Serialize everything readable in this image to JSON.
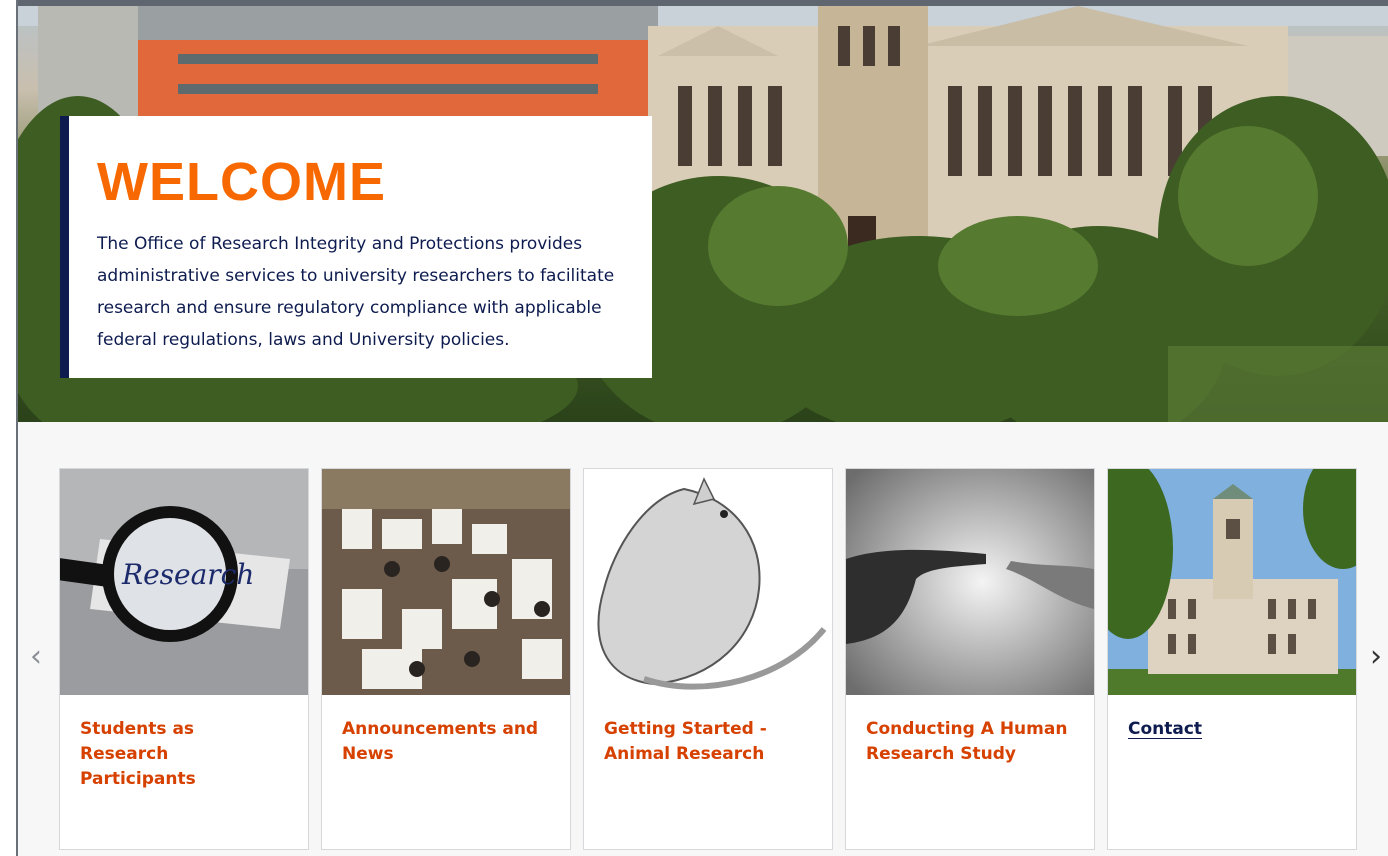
{
  "hero": {
    "title": "WELCOME",
    "description": "The Office of Research Integrity and Protections provides administrative services to university researchers to facilitate research and ensure regulatory compliance with applicable federal regulations, laws and University policies.",
    "accent_color": "#f76900",
    "navy_color": "#0d1b4f"
  },
  "carousel": {
    "prev_icon": "chevron-left-icon",
    "next_icon": "chevron-right-icon",
    "prev_glyph": "‹",
    "next_glyph": "›",
    "cards": [
      {
        "label": "Students as Research Participants",
        "image": "magnifying-glass-research"
      },
      {
        "label": "Announcements and News",
        "image": "poster-session-crowd"
      },
      {
        "label": "Getting Started - Animal Research",
        "image": "rat-illustration"
      },
      {
        "label": "Conducting A Human Research Study",
        "image": "hands-touching"
      },
      {
        "label": "Contact",
        "image": "university-building"
      }
    ],
    "thumb_word": "Research"
  }
}
